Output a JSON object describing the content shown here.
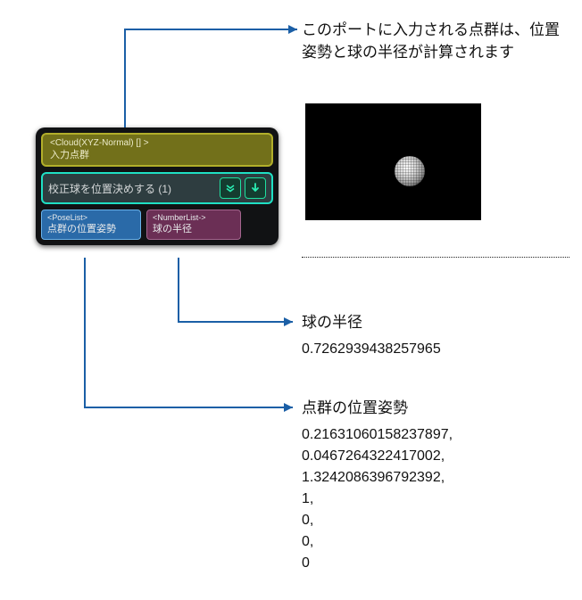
{
  "annotations": {
    "input_description": "このポートに入力される点群は、位置姿勢と球の半径が計算されます",
    "radius_heading": "球の半径",
    "pose_heading": "点群の位置姿勢"
  },
  "node": {
    "input_port": {
      "type": "<Cloud(XYZ-Normal) [] >",
      "label": "入力点群"
    },
    "title": "校正球を位置決めする (1)",
    "output_ports": {
      "pose": {
        "type": "<PoseList>",
        "label": "点群の位置姿勢"
      },
      "number": {
        "type": "<NumberList->",
        "label": "球の半径"
      }
    }
  },
  "values": {
    "radius": "0.7262939438257965",
    "pose": [
      "0.21631060158237897,",
      "0.0467264322417002,",
      "1.3242086396792392,",
      "1,",
      "0,",
      "0,",
      "0"
    ]
  },
  "icons": {
    "chevrons": "chevrons-down-icon",
    "arrow": "arrow-down-icon"
  }
}
